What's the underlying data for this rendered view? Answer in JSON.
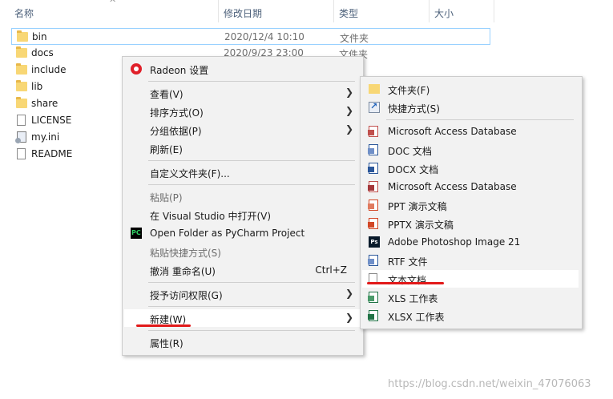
{
  "header": {
    "columns": [
      "名称",
      "修改日期",
      "类型",
      "大小"
    ]
  },
  "files": [
    {
      "name": "bin",
      "date": "2020/12/4 10:10",
      "type": "文件夹"
    },
    {
      "name": "docs",
      "date": "2020/9/23 23:00",
      "type": "文件夹"
    },
    {
      "name": "include"
    },
    {
      "name": "lib"
    },
    {
      "name": "share"
    },
    {
      "name": "LICENSE"
    },
    {
      "name": "my.ini"
    },
    {
      "name": "README"
    }
  ],
  "context_menu": {
    "items": [
      {
        "label": "Radeon 设置"
      },
      {
        "label": "查看(V)"
      },
      {
        "label": "排序方式(O)"
      },
      {
        "label": "分组依据(P)"
      },
      {
        "label": "刷新(E)"
      },
      {
        "label": "自定义文件夹(F)..."
      },
      {
        "label": "粘贴(P)"
      },
      {
        "label": "在 Visual Studio 中打开(V)"
      },
      {
        "label": "Open Folder as PyCharm Project"
      },
      {
        "label": "粘贴快捷方式(S)"
      },
      {
        "label": "撤消 重命名(U)",
        "shortcut": "Ctrl+Z"
      },
      {
        "label": "授予访问权限(G)"
      },
      {
        "label": "新建(W)"
      },
      {
        "label": "属性(R)"
      }
    ]
  },
  "new_submenu": {
    "items": [
      {
        "label": "文件夹(F)"
      },
      {
        "label": "快捷方式(S)"
      },
      {
        "label": "Microsoft Access Database"
      },
      {
        "label": "DOC 文档"
      },
      {
        "label": "DOCX 文档"
      },
      {
        "label": "Microsoft Access Database"
      },
      {
        "label": "PPT 演示文稿"
      },
      {
        "label": "PPTX 演示文稿"
      },
      {
        "label": "Adobe Photoshop Image 21"
      },
      {
        "label": "RTF 文件"
      },
      {
        "label": "文本文档"
      },
      {
        "label": "XLS 工作表"
      },
      {
        "label": "XLSX 工作表"
      }
    ]
  },
  "icons": {
    "pycharm": "PC",
    "photoshop": "Ps",
    "arrow": "❯",
    "sort_caret": "^"
  },
  "watermark": "https://blog.csdn.net/weixin_47076063"
}
